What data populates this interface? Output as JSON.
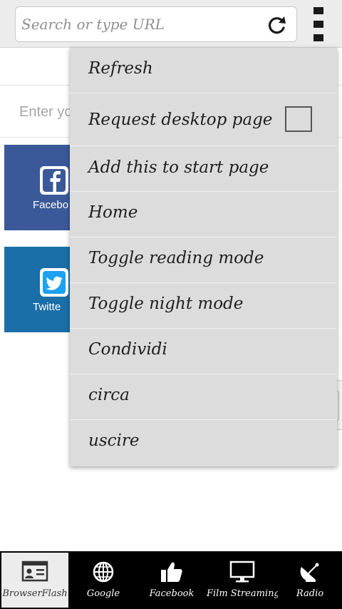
{
  "toolbar": {
    "search_placeholder": "Search or type URL",
    "reload_icon": "reload-icon",
    "menu_icon": "overflow-menu-icon"
  },
  "background": {
    "enter_text": "Enter yo",
    "tiles": [
      {
        "label": "Facebo",
        "color": "#3b5998",
        "icon": "facebook-icon"
      },
      {
        "label": "Twitte",
        "color": "#1b6fa8",
        "icon": "twitter-icon"
      }
    ]
  },
  "menu": {
    "items": [
      {
        "label": "Refresh"
      },
      {
        "label": "Request desktop page",
        "checkbox": false
      },
      {
        "label": "Add this to start page"
      },
      {
        "label": "Home"
      },
      {
        "label": "Toggle reading mode"
      },
      {
        "label": "Toggle night mode"
      },
      {
        "label": "Condividi"
      },
      {
        "label": "circa"
      },
      {
        "label": "uscire"
      }
    ]
  },
  "bottom_nav": {
    "items": [
      {
        "label": "BrowserFlash",
        "icon": "browser-icon",
        "active": true
      },
      {
        "label": "Google",
        "icon": "globe-icon",
        "active": false
      },
      {
        "label": "Facebook",
        "icon": "thumbs-up-icon",
        "active": false
      },
      {
        "label": "Film Streaming",
        "icon": "monitor-icon",
        "active": false
      },
      {
        "label": "Radio",
        "icon": "satellite-dish-icon",
        "active": false
      }
    ]
  }
}
